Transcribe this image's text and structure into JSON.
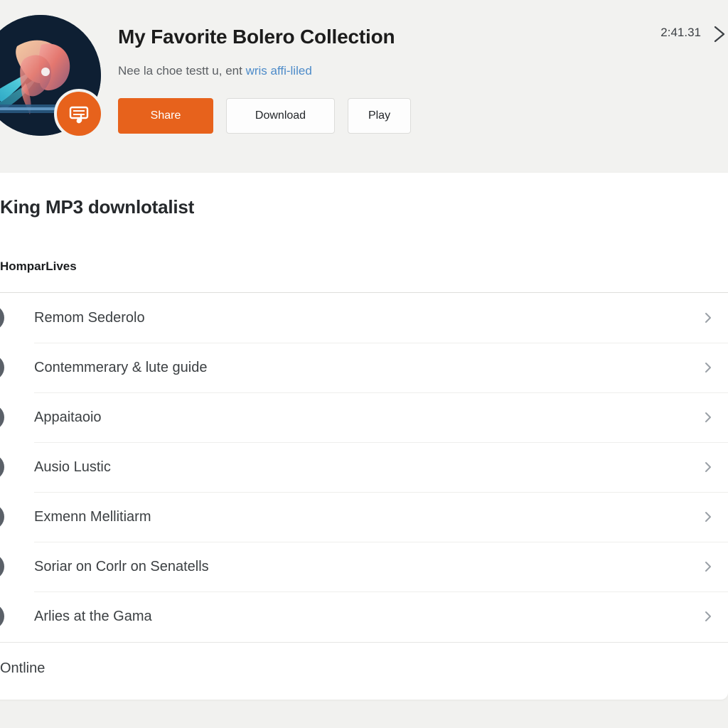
{
  "header": {
    "title": "My Favorite Bolero Collection",
    "subtitle_text": "Nee la choe testt u, ent ",
    "subtitle_link": "wris affi-liled",
    "duration": "2:41.31",
    "next_icon": "chevron-right-icon",
    "avatar_icon": "profile-artwork-avatar",
    "badge_icon": "music-sheet-icon",
    "buttons": [
      {
        "label": "Share",
        "style": "primary",
        "name": "share-button"
      },
      {
        "label": "Download",
        "style": "secondary",
        "name": "download-button"
      },
      {
        "label": "Play",
        "style": "secondary",
        "name": "play-button"
      }
    ]
  },
  "colors": {
    "accent_orange": "#e7621c",
    "link_blue": "#4d8bc9",
    "header_bg": "#f2f2f0",
    "page_bg": "#f1f1ef",
    "card_bg": "#ffffff",
    "icon_badge": "#5a6068"
  },
  "card": {
    "title": "King MP3 downlotalist",
    "subheading": "HomparLives",
    "footer_label": "Ontline",
    "rows": [
      {
        "label": "Remom Sederolo",
        "icon": "document-lines-icon"
      },
      {
        "label": "Contemmerary & lute guide",
        "icon": "microphone-icon"
      },
      {
        "label": "Appaitaoio",
        "icon": "plus-icon"
      },
      {
        "label": "Ausio Lustic",
        "icon": "music-notes-icon"
      },
      {
        "label": "Exmenn Mellitiarm",
        "icon": "inbox-download-icon"
      },
      {
        "label": "Soriar on Corlr on Senatells",
        "icon": "target-circle-icon"
      },
      {
        "label": "Arlies at the Gama",
        "icon": "media-box-icon"
      }
    ]
  }
}
